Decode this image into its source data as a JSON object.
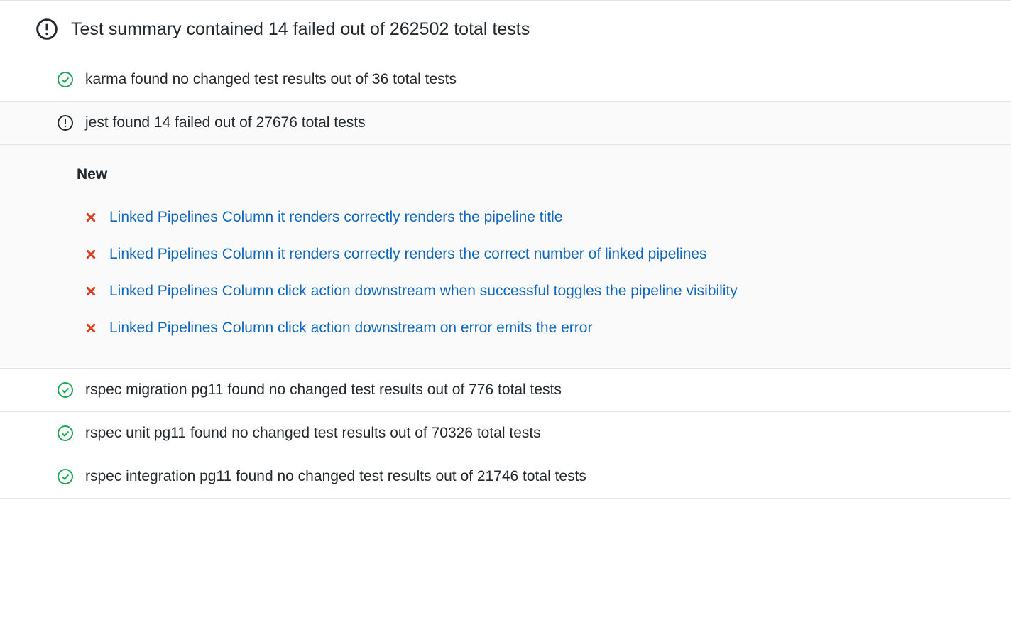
{
  "summary": {
    "text": "Test summary contained 14 failed out of 262502 total tests"
  },
  "suites": [
    {
      "status": "passed",
      "text": "karma found no changed test results out of 36 total tests",
      "expanded": false
    },
    {
      "status": "failed",
      "text": "jest found 14 failed out of 27676 total tests",
      "expanded": true,
      "section_label": "New",
      "tests": [
        {
          "status": "failed",
          "name": "Linked Pipelines Column it renders correctly renders the pipeline title"
        },
        {
          "status": "failed",
          "name": "Linked Pipelines Column it renders correctly renders the correct number of linked pipelines"
        },
        {
          "status": "failed",
          "name": "Linked Pipelines Column click action downstream when successful toggles the pipeline visibility"
        },
        {
          "status": "failed",
          "name": "Linked Pipelines Column click action downstream on error emits the error"
        }
      ]
    },
    {
      "status": "passed",
      "text": "rspec migration pg11 found no changed test results out of 776 total tests",
      "expanded": false
    },
    {
      "status": "passed",
      "text": "rspec unit pg11 found no changed test results out of 70326 total tests",
      "expanded": false
    },
    {
      "status": "passed",
      "text": "rspec integration pg11 found no changed test results out of 21746 total tests",
      "expanded": false
    }
  ]
}
